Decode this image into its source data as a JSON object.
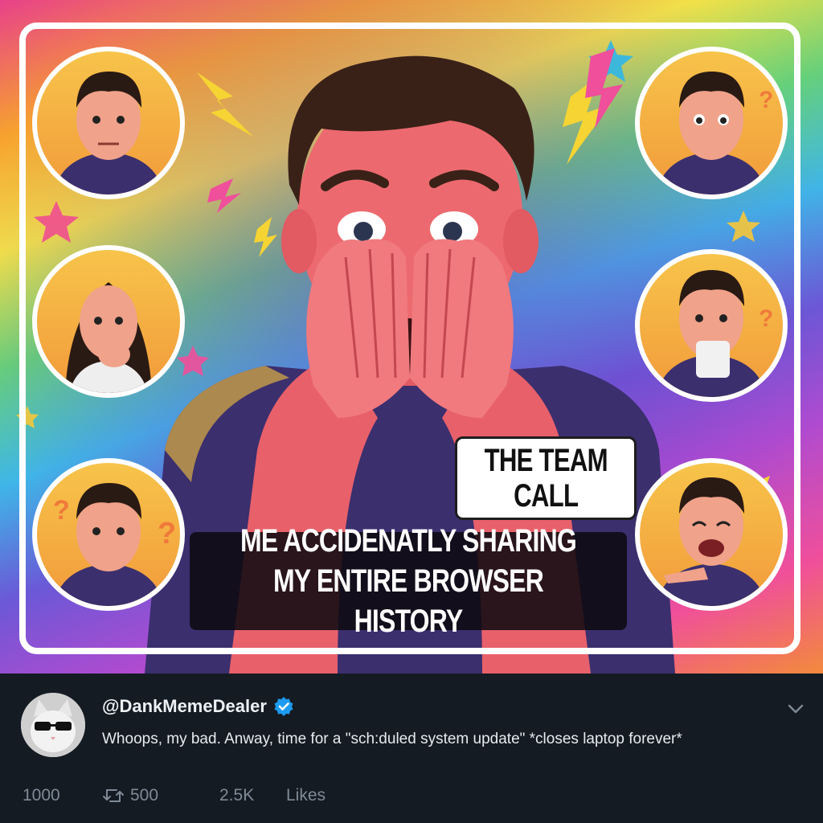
{
  "meme": {
    "caption_top": "THE TEAM\nCALL",
    "caption_bottom": "ME ACCIDENATLY SHARING MY ENTIRE BROWSER HISTORY"
  },
  "tweet": {
    "username": "@DankMemeDealer",
    "verified": true,
    "text": "Whoops, my bad. Anway, time for a \"sch:duled system update\" *closes laptop forever*",
    "stats": {
      "replies": "1000",
      "retweets": "500",
      "likes_count": "2.5K",
      "likes_label": "Likes"
    }
  },
  "colors": {
    "background": "#151b23",
    "verified_blue": "#1d9bf0",
    "stat_gray": "#7f8a96"
  },
  "icons": [
    "verified-badge-icon",
    "chevron-down-icon",
    "retweet-icon"
  ]
}
